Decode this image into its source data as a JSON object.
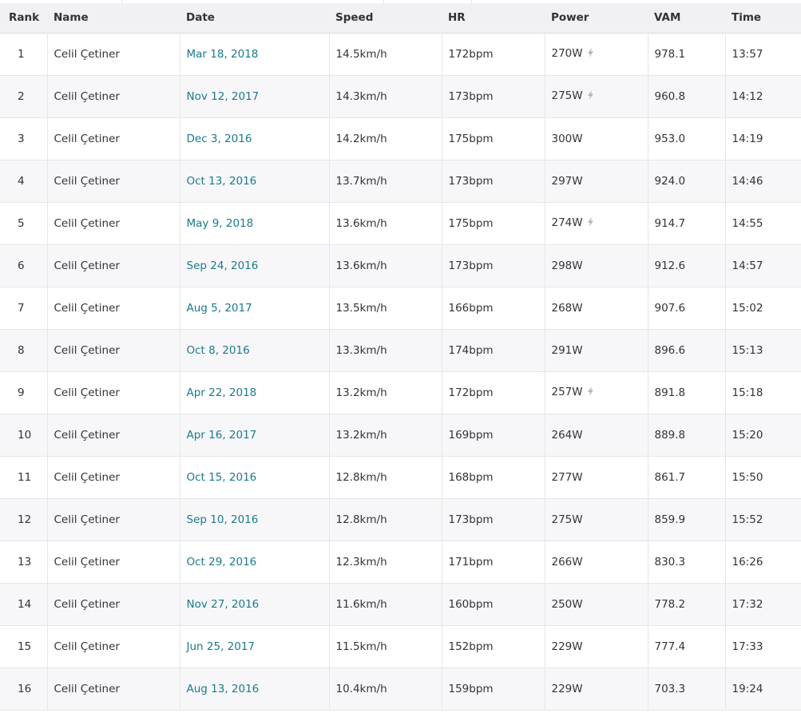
{
  "columns": {
    "rank": "Rank",
    "name": "Name",
    "date": "Date",
    "speed": "Speed",
    "hr": "HR",
    "power": "Power",
    "vam": "VAM",
    "time": "Time"
  },
  "rows": [
    {
      "rank": "1",
      "name": "Celil Çetiner",
      "date": "Mar 18, 2018",
      "speed": "14.5km/h",
      "hr": "172bpm",
      "power": "270W",
      "estimated": true,
      "vam": "978.1",
      "time": "13:57"
    },
    {
      "rank": "2",
      "name": "Celil Çetiner",
      "date": "Nov 12, 2017",
      "speed": "14.3km/h",
      "hr": "173bpm",
      "power": "275W",
      "estimated": true,
      "vam": "960.8",
      "time": "14:12"
    },
    {
      "rank": "3",
      "name": "Celil Çetiner",
      "date": "Dec 3, 2016",
      "speed": "14.2km/h",
      "hr": "175bpm",
      "power": "300W",
      "estimated": false,
      "vam": "953.0",
      "time": "14:19"
    },
    {
      "rank": "4",
      "name": "Celil Çetiner",
      "date": "Oct 13, 2016",
      "speed": "13.7km/h",
      "hr": "173bpm",
      "power": "297W",
      "estimated": false,
      "vam": "924.0",
      "time": "14:46"
    },
    {
      "rank": "5",
      "name": "Celil Çetiner",
      "date": "May 9, 2018",
      "speed": "13.6km/h",
      "hr": "175bpm",
      "power": "274W",
      "estimated": true,
      "vam": "914.7",
      "time": "14:55"
    },
    {
      "rank": "6",
      "name": "Celil Çetiner",
      "date": "Sep 24, 2016",
      "speed": "13.6km/h",
      "hr": "173bpm",
      "power": "298W",
      "estimated": false,
      "vam": "912.6",
      "time": "14:57"
    },
    {
      "rank": "7",
      "name": "Celil Çetiner",
      "date": "Aug 5, 2017",
      "speed": "13.5km/h",
      "hr": "166bpm",
      "power": "268W",
      "estimated": false,
      "vam": "907.6",
      "time": "15:02"
    },
    {
      "rank": "8",
      "name": "Celil Çetiner",
      "date": "Oct 8, 2016",
      "speed": "13.3km/h",
      "hr": "174bpm",
      "power": "291W",
      "estimated": false,
      "vam": "896.6",
      "time": "15:13"
    },
    {
      "rank": "9",
      "name": "Celil Çetiner",
      "date": "Apr 22, 2018",
      "speed": "13.2km/h",
      "hr": "172bpm",
      "power": "257W",
      "estimated": true,
      "vam": "891.8",
      "time": "15:18"
    },
    {
      "rank": "10",
      "name": "Celil Çetiner",
      "date": "Apr 16, 2017",
      "speed": "13.2km/h",
      "hr": "169bpm",
      "power": "264W",
      "estimated": false,
      "vam": "889.8",
      "time": "15:20"
    },
    {
      "rank": "11",
      "name": "Celil Çetiner",
      "date": "Oct 15, 2016",
      "speed": "12.8km/h",
      "hr": "168bpm",
      "power": "277W",
      "estimated": false,
      "vam": "861.7",
      "time": "15:50"
    },
    {
      "rank": "12",
      "name": "Celil Çetiner",
      "date": "Sep 10, 2016",
      "speed": "12.8km/h",
      "hr": "173bpm",
      "power": "275W",
      "estimated": false,
      "vam": "859.9",
      "time": "15:52"
    },
    {
      "rank": "13",
      "name": "Celil Çetiner",
      "date": "Oct 29, 2016",
      "speed": "12.3km/h",
      "hr": "171bpm",
      "power": "266W",
      "estimated": false,
      "vam": "830.3",
      "time": "16:26"
    },
    {
      "rank": "14",
      "name": "Celil Çetiner",
      "date": "Nov 27, 2016",
      "speed": "11.6km/h",
      "hr": "160bpm",
      "power": "250W",
      "estimated": false,
      "vam": "778.2",
      "time": "17:32"
    },
    {
      "rank": "15",
      "name": "Celil Çetiner",
      "date": "Jun 25, 2017",
      "speed": "11.5km/h",
      "hr": "152bpm",
      "power": "229W",
      "estimated": false,
      "vam": "777.4",
      "time": "17:33"
    },
    {
      "rank": "16",
      "name": "Celil Çetiner",
      "date": "Aug 13, 2016",
      "speed": "10.4km/h",
      "hr": "159bpm",
      "power": "229W",
      "estimated": false,
      "vam": "703.3",
      "time": "19:24"
    }
  ],
  "icons": {
    "estimated_power": "lightning-bolt-icon"
  },
  "colors": {
    "link": "#1a7a8c",
    "header_bg": "#f0f0f5",
    "row_alt_bg": "#f7f7fa",
    "bolt": "#b5b5b5"
  }
}
